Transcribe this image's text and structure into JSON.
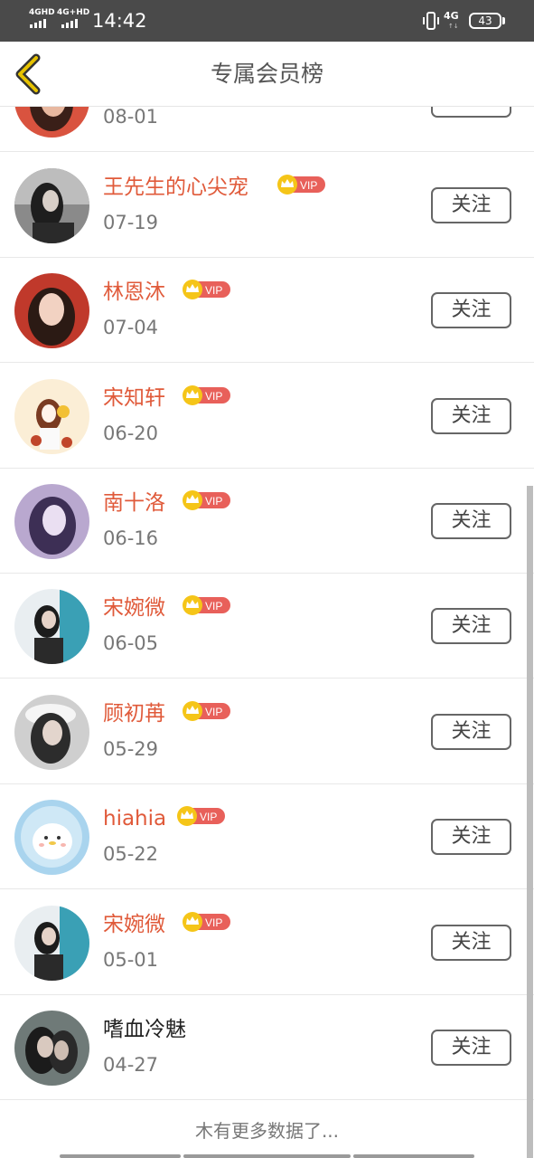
{
  "status_bar": {
    "sim1": "4GHD",
    "sim2": "4G+HD",
    "time": "14:42",
    "network": "4G",
    "network_sub": "↑↓",
    "battery": "43"
  },
  "header": {
    "title": "专属会员榜",
    "back_icon": "chevron-left-icon"
  },
  "colors": {
    "vip_name": "#e05a3a",
    "vip_badge": "#e8605a",
    "crown": "#f5c518",
    "back_arrow": "#e6b800"
  },
  "members": [
    {
      "name": "",
      "date": "08-01",
      "vip": true,
      "follow_label": "关注"
    },
    {
      "name": "王先生的心尖宠",
      "date": "07-19",
      "vip": true,
      "follow_label": "关注"
    },
    {
      "name": "林恩沐",
      "date": "07-04",
      "vip": true,
      "follow_label": "关注"
    },
    {
      "name": "宋知轩",
      "date": "06-20",
      "vip": true,
      "follow_label": "关注"
    },
    {
      "name": "南十洛",
      "date": "06-16",
      "vip": true,
      "follow_label": "关注"
    },
    {
      "name": "宋婉微",
      "date": "06-05",
      "vip": true,
      "follow_label": "关注"
    },
    {
      "name": "顾初苒",
      "date": "05-29",
      "vip": true,
      "follow_label": "关注"
    },
    {
      "name": "hiahia",
      "date": "05-22",
      "vip": true,
      "follow_label": "关注"
    },
    {
      "name": "宋婉微",
      "date": "05-01",
      "vip": true,
      "follow_label": "关注"
    },
    {
      "name": "嗜血冷魅",
      "date": "04-27",
      "vip": false,
      "follow_label": "关注"
    }
  ],
  "vip_label": "VIP",
  "footer": {
    "end_text": "木有更多数据了..."
  }
}
